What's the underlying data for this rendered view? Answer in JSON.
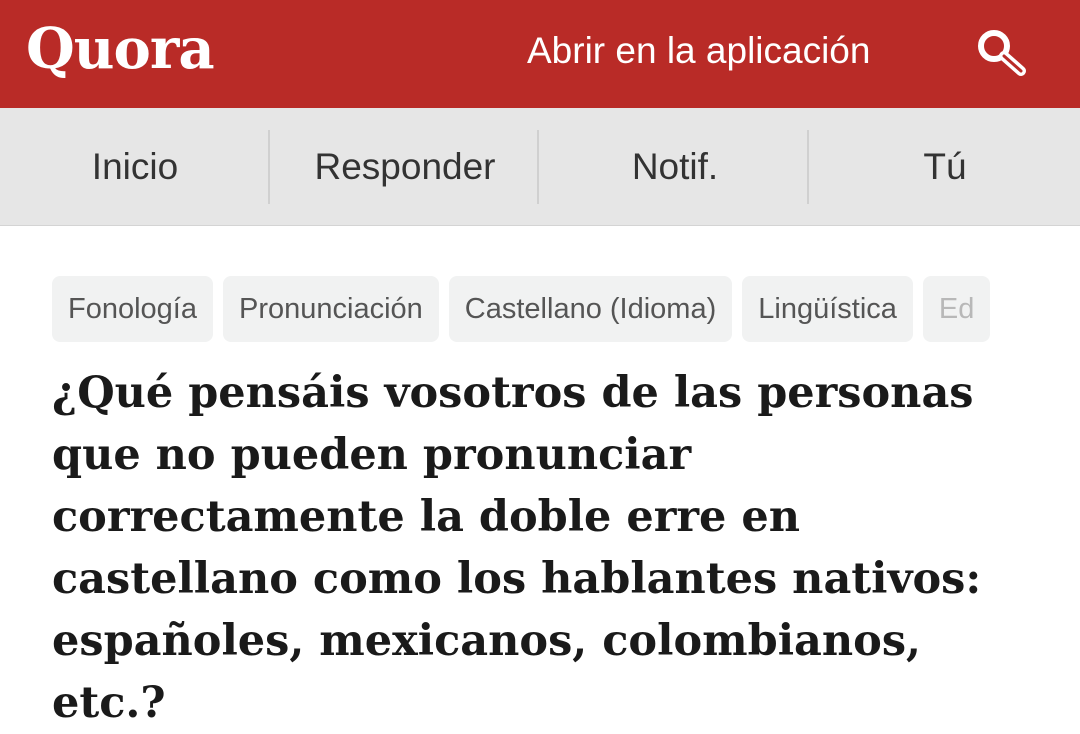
{
  "header": {
    "logo": "Quora",
    "open_app": "Abrir en la aplicación",
    "search_icon": "search-icon",
    "brand_color": "#b92b27"
  },
  "nav": {
    "items": [
      {
        "label": "Inicio"
      },
      {
        "label": "Responder"
      },
      {
        "label": "Notif."
      },
      {
        "label": "Tú"
      }
    ]
  },
  "topics": [
    {
      "label": "Fonología"
    },
    {
      "label": "Pronunciación"
    },
    {
      "label": "Castellano (Idioma)"
    },
    {
      "label": "Lingüística"
    },
    {
      "label": "Ed"
    }
  ],
  "question": {
    "title": "¿Qué pensáis vosotros de las personas que no pueden pronunciar correctamente la doble erre en castellano como los hablantes nativos: españoles, mexicanos, colombianos, etc.?"
  }
}
